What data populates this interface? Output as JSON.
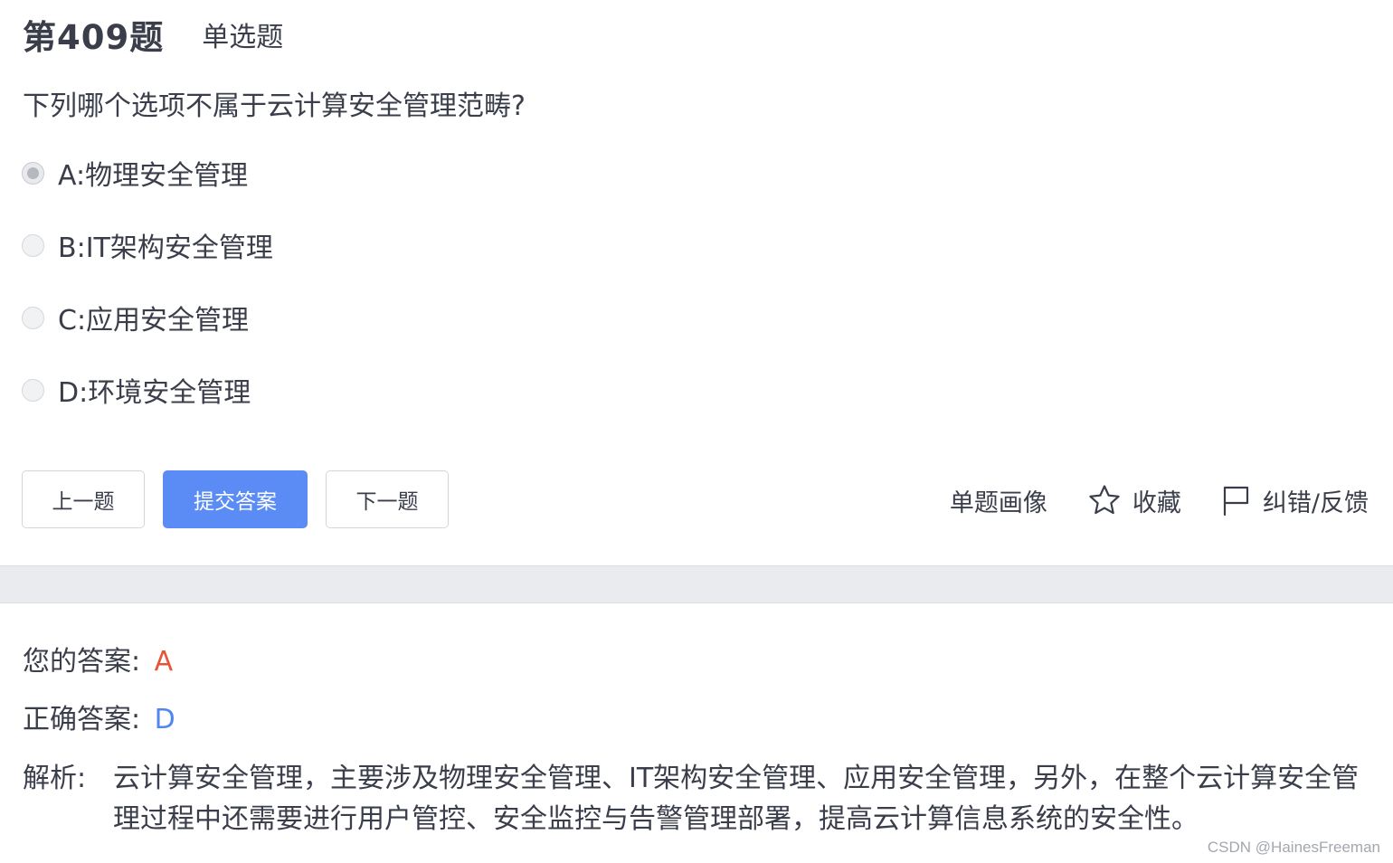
{
  "question": {
    "number": "第409题",
    "type": "单选题",
    "text": "下列哪个选项不属于云计算安全管理范畴?"
  },
  "options": [
    {
      "label": "A:物理安全管理",
      "selected": true
    },
    {
      "label": "B:IT架构安全管理",
      "selected": false
    },
    {
      "label": "C:应用安全管理",
      "selected": false
    },
    {
      "label": "D:环境安全管理",
      "selected": false
    }
  ],
  "buttons": {
    "prev": "上一题",
    "submit": "提交答案",
    "next": "下一题"
  },
  "tools": {
    "portrait": "单题画像",
    "favorite": "收藏",
    "feedback": "纠错/反馈"
  },
  "result": {
    "your_answer_label": "您的答案:",
    "your_answer": "A",
    "correct_answer_label": "正确答案:",
    "correct_answer": "D",
    "analysis_label": "解析:",
    "analysis_text": "云计算安全管理，主要涉及物理安全管理、IT架构安全管理、应用安全管理，另外，在整个云计算安全管理过程中还需要进行用户管控、安全监控与告警管理部署，提高云计算信息系统的安全性。"
  },
  "colors": {
    "primary": "#5b8cf5",
    "wrong": "#e6543a",
    "correct": "#4f86f0"
  },
  "watermark": "CSDN @HainesFreeman"
}
